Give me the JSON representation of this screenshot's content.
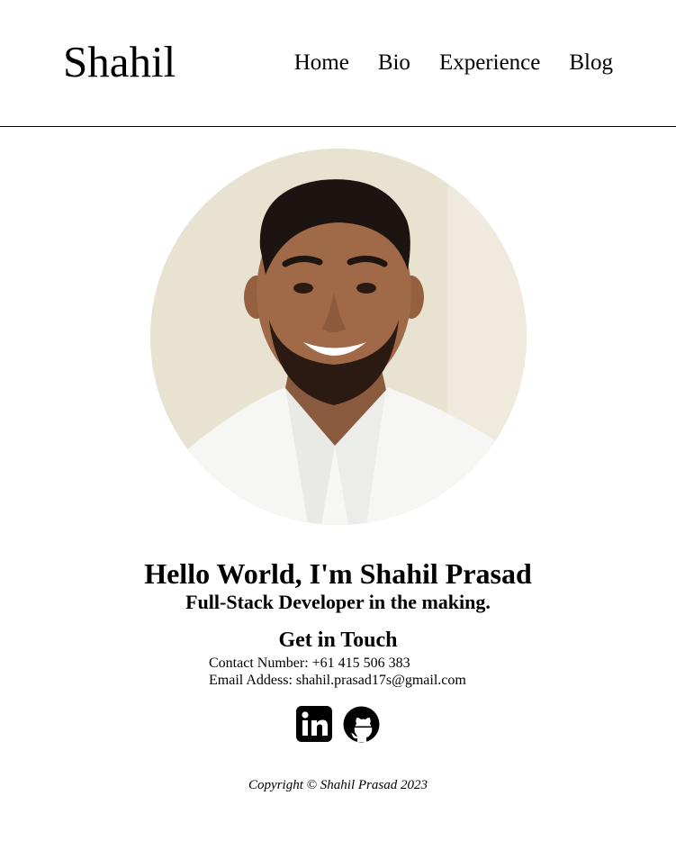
{
  "header": {
    "brand": "Shahil",
    "nav": [
      "Home",
      "Bio",
      "Experience",
      "Blog"
    ]
  },
  "hero": {
    "portrait_alt": "Portrait of Shahil Prasad",
    "title": "Hello World, I'm Shahil Prasad",
    "subtitle": "Full-Stack Developer in the making."
  },
  "contact": {
    "title": "Get in Touch",
    "phone": "Contact Number: +61 415 506 383",
    "email": "Email Addess: shahil.prasad17s@gmail.com"
  },
  "socials": [
    {
      "icon": "linkedin-icon"
    },
    {
      "icon": "github-icon"
    }
  ],
  "footer": {
    "copyright": "Copyright © Shahil Prasad 2023"
  }
}
